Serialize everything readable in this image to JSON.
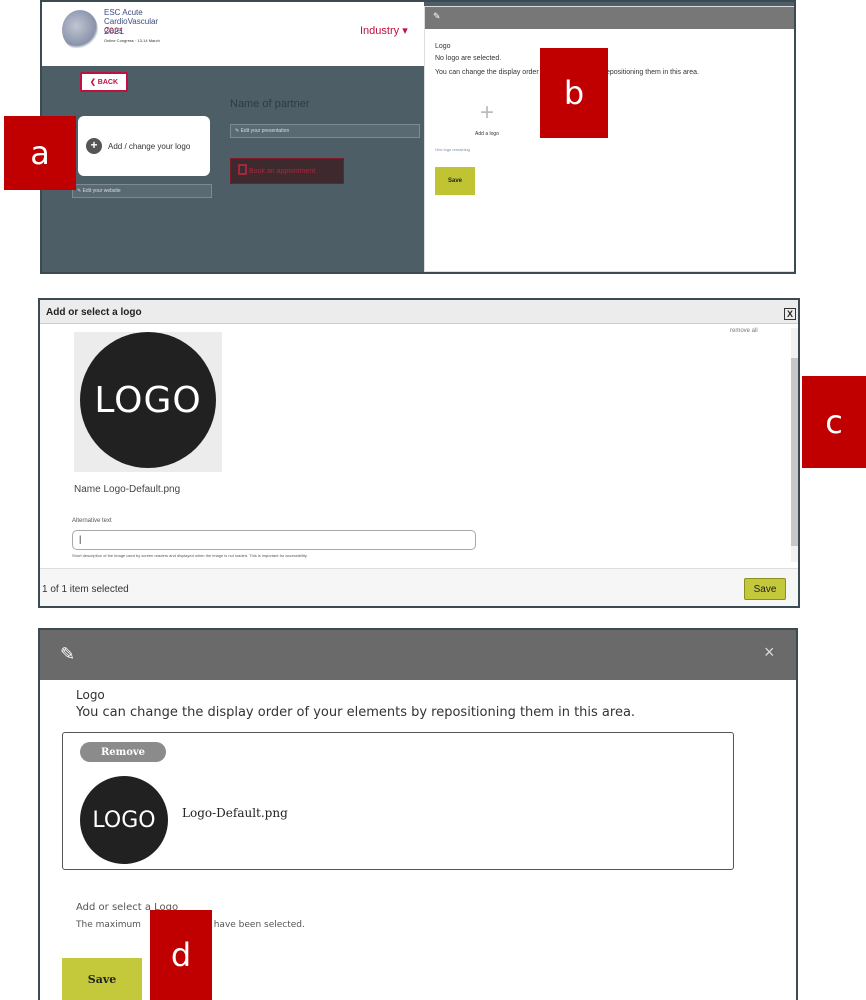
{
  "panel_labels": {
    "a": "a",
    "b": "b",
    "c": "c",
    "d": "d"
  },
  "panel1": {
    "event_title": "ESC Acute CardioVascular",
    "event_title2": "Care",
    "event_year": "2021",
    "event_sub": "Online Congress · 13-14 March",
    "industry": "Industry",
    "back": "BACK",
    "add_logo_card": "Add / change your logo",
    "website_field": "Edit your website",
    "partner_name": "Name of partner",
    "presentation_field": "Edit your presentation",
    "appointment_button": "Book an appointment",
    "modal": {
      "title": "Logo",
      "no_logo": "No logo are selected.",
      "change_order": "You can change the display order of your elements by repositioning them in this area.",
      "add_logo": "Add a logo",
      "remaining": "One logo remaining",
      "save": "Save"
    }
  },
  "panel2": {
    "header": "Add or select a logo",
    "close": "X",
    "partial_text": "remove all",
    "logo_text": "LOGO",
    "name_line": "Name Logo-Default.png",
    "alt_label": "Alternative text",
    "alt_value": "|",
    "alt_help": "Short description of the image used by screen readers and displayed when the image is not loaded. This is important for accessibility.",
    "status": "1 of 1 item selected",
    "save": "Save"
  },
  "panel3": {
    "close": "×",
    "title": "Logo",
    "description": "You can change the display order of your elements by repositioning them in this area.",
    "remove": "Remove",
    "logo_text": "LOGO",
    "file_name": "Logo-Default.png",
    "add_label": "Add or select a Logo",
    "max_text_1": "The maximum",
    "max_text_2": "gos have been selected.",
    "save": "Save"
  }
}
